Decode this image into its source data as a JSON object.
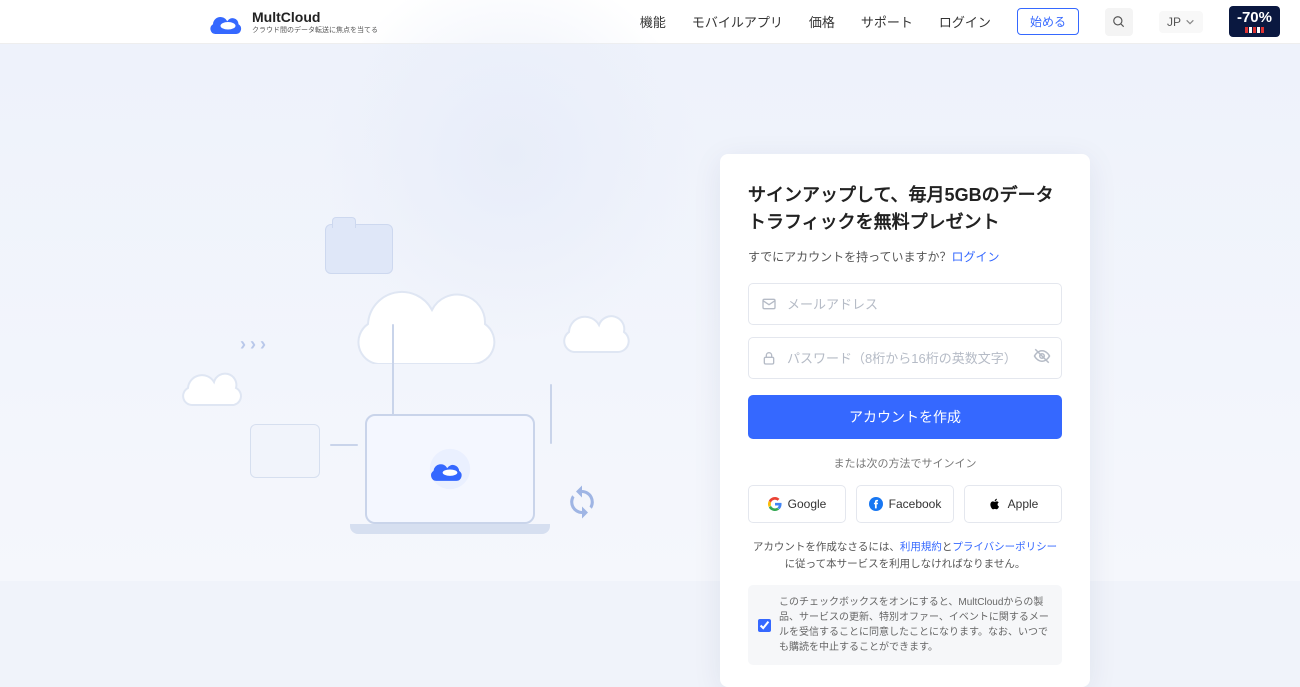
{
  "brand": {
    "name": "MultCloud",
    "tagline": "クラウド間のデータ転送に焦点を当てる"
  },
  "nav": {
    "features": "機能",
    "mobile": "モバイルアプリ",
    "pricing": "価格",
    "support": "サポート",
    "login": "ログイン",
    "start": "始める",
    "lang": "JP"
  },
  "promo": {
    "label": "-70%"
  },
  "signup": {
    "title": "サインアップして、毎月5GBのデータトラフィックを無料プレゼント",
    "already_prefix": "すでにアカウントを持っていますか？",
    "login_link": "ログイン",
    "email_placeholder": "メールアドレス",
    "password_placeholder": "パスワード（8桁から16桁の英数文字）",
    "create_button": "アカウントを作成",
    "or_text": "または次の方法でサインイン",
    "social": {
      "google": "Google",
      "facebook": "Facebook",
      "apple": "Apple"
    },
    "terms_prefix": "アカウントを作成なさるには、",
    "terms_link": "利用規約",
    "terms_and": "と",
    "privacy_link": "プライバシーポリシー",
    "terms_suffix": "に従って本サービスを利用しなければなりません。",
    "consent": "このチェックボックスをオンにすると、MultCloudからの製品、サービスの更新、特別オファー、イベントに関するメールを受信することに同意したことになります。なお、いつでも購読を中止することができます。"
  }
}
